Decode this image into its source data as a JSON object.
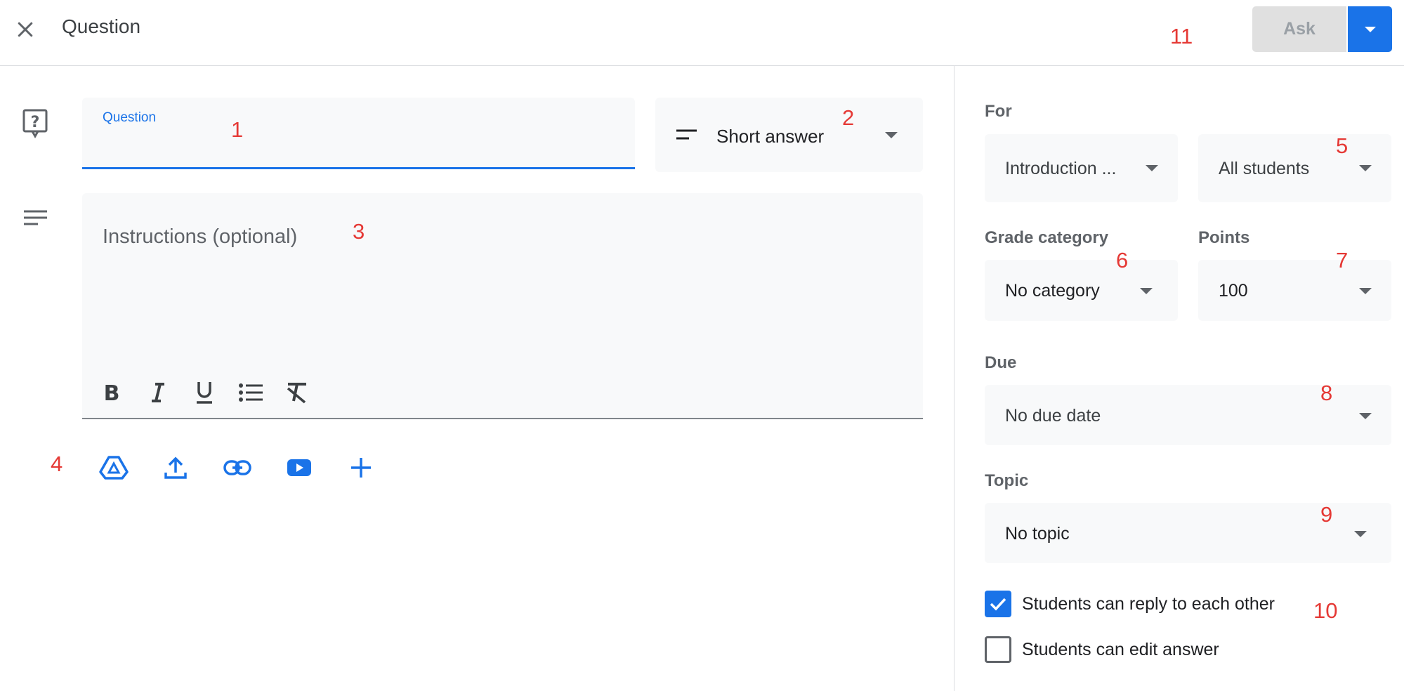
{
  "header": {
    "title": "Question",
    "ask_label": "Ask"
  },
  "question": {
    "label": "Question",
    "type": "Short answer",
    "instructions_placeholder": "Instructions (optional)"
  },
  "formatting": [
    "bold",
    "italic",
    "underline",
    "bulleted-list",
    "clear-formatting"
  ],
  "attachments": [
    "google-drive",
    "upload",
    "link",
    "youtube",
    "create"
  ],
  "settings": {
    "for_label": "For",
    "class_value": "Introduction ...",
    "students_value": "All students",
    "grade_category_label": "Grade category",
    "grade_category_value": "No category",
    "points_label": "Points",
    "points_value": "100",
    "due_label": "Due",
    "due_value": "No due date",
    "topic_label": "Topic",
    "topic_value": "No topic",
    "reply_label": "Students can reply to each other",
    "reply_checked": true,
    "edit_label": "Students can edit answer",
    "edit_checked": false
  },
  "markers": [
    "1",
    "2",
    "3",
    "4",
    "5",
    "6",
    "7",
    "8",
    "9",
    "10",
    "11"
  ],
  "colors": {
    "accent": "#1a73e8",
    "marker": "#e53935",
    "field_bg": "#f8f9fa"
  }
}
